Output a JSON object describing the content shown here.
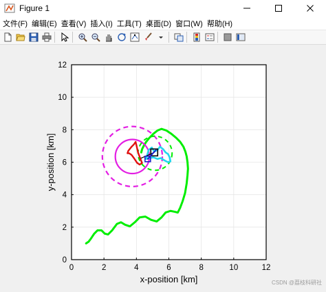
{
  "window": {
    "title": "Figure 1"
  },
  "menu": [
    "文件(F)",
    "编辑(E)",
    "查看(V)",
    "插入(I)",
    "工具(T)",
    "桌面(D)",
    "窗口(W)",
    "帮助(H)"
  ],
  "toolbar": {
    "icons": [
      "new-figure-icon",
      "open-file-icon",
      "save-icon",
      "print-icon",
      "pointer-icon",
      "zoom-in-icon",
      "zoom-out-icon",
      "pan-icon",
      "rotate-3d-icon",
      "data-cursor-icon",
      "brush-icon",
      "link-plot-icon",
      "colorbar-icon",
      "legend-icon",
      "hide-plot-tools-icon",
      "show-plot-tools-icon"
    ]
  },
  "chart_data": {
    "type": "line",
    "xlabel": "x-position [km]",
    "ylabel": "y-position [km]",
    "xlim": [
      0,
      12
    ],
    "ylim": [
      0,
      12
    ],
    "xticks": [
      "0",
      "2",
      "4",
      "6",
      "8",
      "10",
      "12"
    ],
    "yticks": [
      "0",
      "2",
      "4",
      "6",
      "8",
      "10",
      "12"
    ],
    "grid": true,
    "colors": {
      "path": "#00ee00",
      "circle": "#e31ee3",
      "red_track": "#e01010",
      "cyan_track": "#22d6ee",
      "blue_marker": "#1a20c8"
    },
    "series": [
      {
        "color": "green-solid",
        "x": [
          0.9,
          1.05,
          1.2,
          1.4,
          1.6,
          1.85,
          2.05,
          2.25,
          2.5,
          2.8,
          3.05,
          3.3,
          3.6,
          3.9,
          4.2,
          4.55,
          4.9,
          5.25,
          5.55,
          5.8,
          6.1,
          6.35,
          6.55,
          6.7,
          6.85,
          7.0,
          7.1,
          7.15,
          7.18,
          7.15,
          7.1,
          7.02,
          6.9,
          6.7,
          6.45,
          6.15,
          5.85,
          5.55,
          5.3,
          5.05,
          4.8,
          4.6,
          4.45,
          4.35,
          4.3
        ],
        "y": [
          1.0,
          1.1,
          1.3,
          1.6,
          1.8,
          1.8,
          1.6,
          1.55,
          1.8,
          2.2,
          2.3,
          2.15,
          2.05,
          2.3,
          2.6,
          2.65,
          2.45,
          2.35,
          2.6,
          2.9,
          3.0,
          2.95,
          2.9,
          3.2,
          3.6,
          4.1,
          4.7,
          5.2,
          5.6,
          6.0,
          6.35,
          6.65,
          6.95,
          7.25,
          7.5,
          7.75,
          7.95,
          8.05,
          7.95,
          7.75,
          7.5,
          7.25,
          7.0,
          6.8,
          6.6
        ]
      },
      {
        "color": "magenta-solid-circle",
        "center": [
          3.75,
          6.35
        ],
        "radius": 1.05
      },
      {
        "color": "magenta-dashed-circle",
        "center": [
          3.75,
          6.35
        ],
        "radius": 1.85
      },
      {
        "color": "green-dashed-arc",
        "center": [
          5.15,
          6.55
        ],
        "radius": 1.05
      },
      {
        "color": "red-solid",
        "x": [
          3.45,
          3.5,
          3.7,
          3.85,
          3.95,
          4.0,
          4.1,
          4.25,
          4.35,
          4.2,
          4.05,
          3.95,
          3.85,
          3.7,
          3.55,
          3.45
        ],
        "y": [
          6.55,
          6.7,
          6.95,
          7.1,
          7.25,
          7.05,
          6.6,
          6.2,
          5.95,
          5.85,
          5.95,
          6.1,
          6.25,
          6.45,
          6.55,
          6.55
        ]
      },
      {
        "color": "cyan-solid",
        "x": [
          4.6,
          4.75,
          4.95,
          5.1,
          5.3,
          5.45,
          5.65,
          5.8,
          5.95,
          6.05,
          6.1,
          5.95,
          5.75,
          5.5,
          5.3,
          5.05,
          4.8,
          4.6
        ],
        "y": [
          6.2,
          6.75,
          6.9,
          6.65,
          6.75,
          6.95,
          6.8,
          6.6,
          6.5,
          6.3,
          6.05,
          6.0,
          6.1,
          6.25,
          6.2,
          6.3,
          6.25,
          6.2
        ]
      },
      {
        "color": "black-marker",
        "x": [
          4.3,
          5.1
        ],
        "y": [
          6.25,
          6.6
        ]
      },
      {
        "color": "blue-marker",
        "x": [
          4.7,
          5.2
        ],
        "y": [
          6.2,
          6.75
        ]
      }
    ]
  },
  "watermark": "CSDN @荔枝科研社"
}
